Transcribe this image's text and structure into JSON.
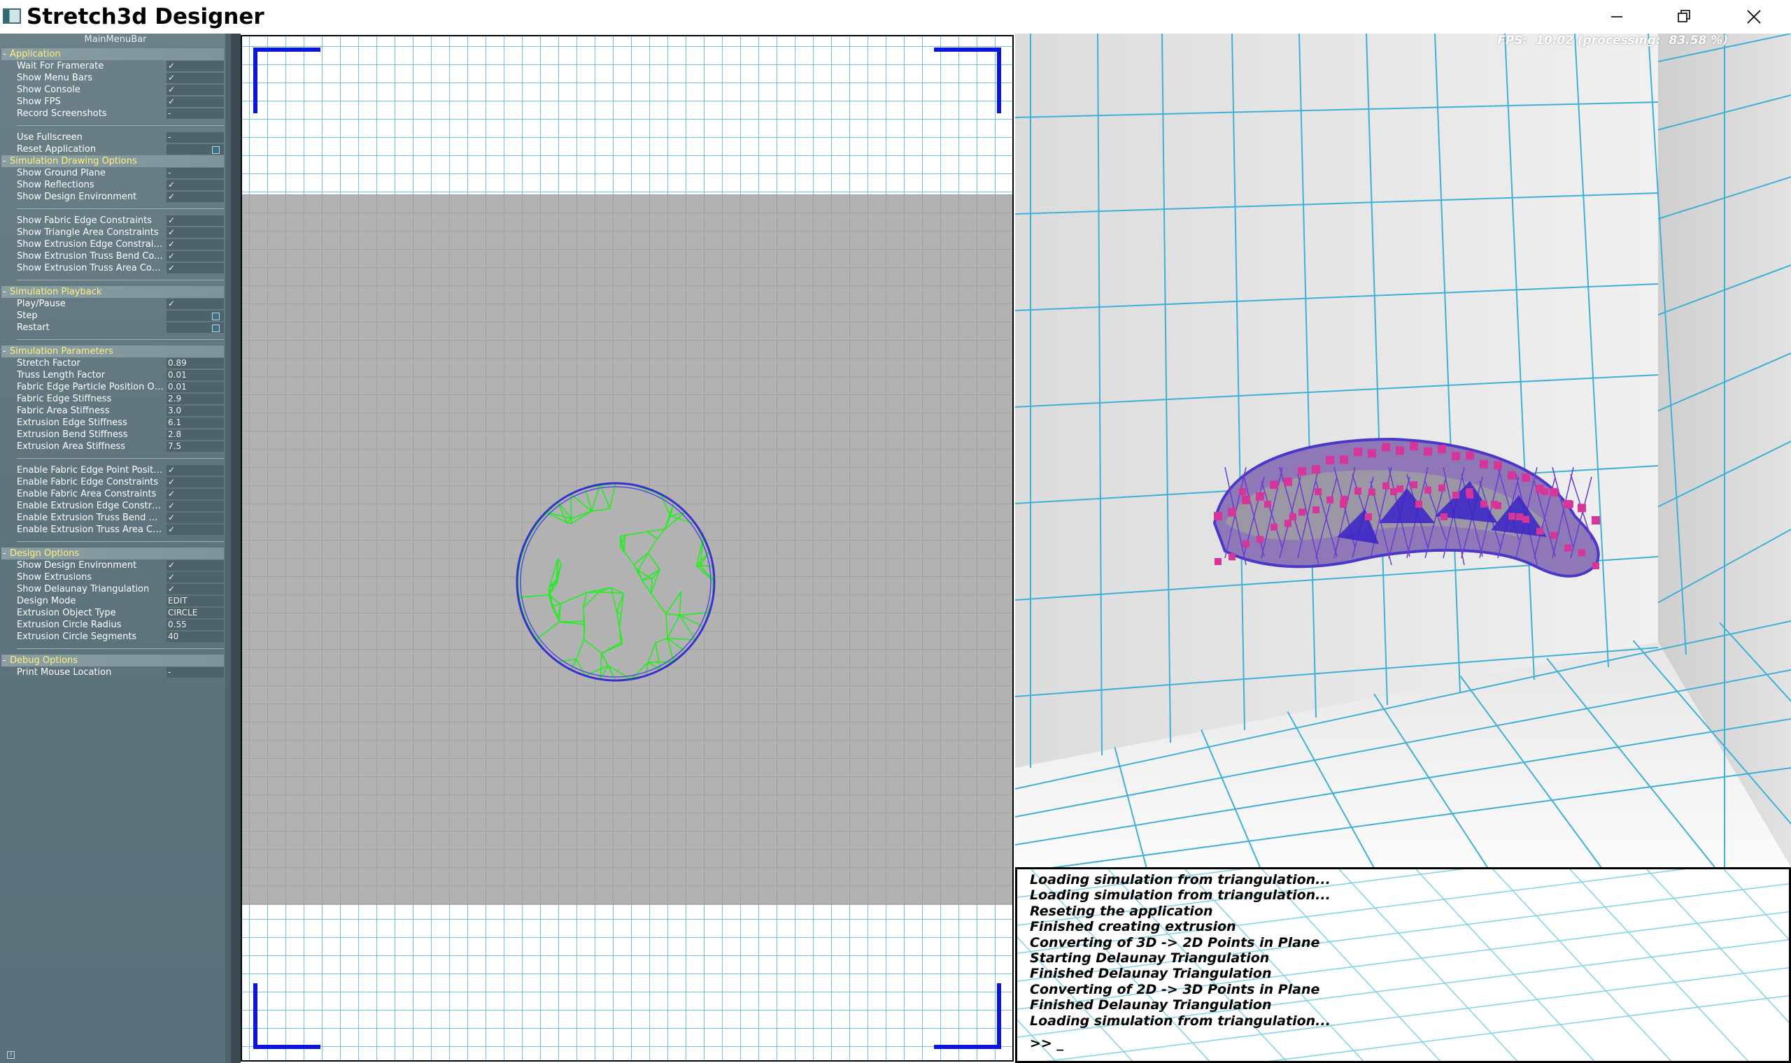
{
  "window": {
    "title": "Stretch3d Designer",
    "controls": {
      "minimize_icon": "minimize-icon",
      "restore_icon": "restore-icon",
      "close_icon": "close-icon"
    }
  },
  "menu_panel": {
    "title": "MainMenuBar",
    "rows": [
      {
        "kind": "section",
        "label": "Application"
      },
      {
        "kind": "item",
        "label": "Wait For Framerate",
        "value": "✓",
        "type": "check"
      },
      {
        "kind": "item",
        "label": "Show Menu Bars",
        "value": "✓",
        "type": "check"
      },
      {
        "kind": "item",
        "label": "Show Console",
        "value": "✓",
        "type": "check"
      },
      {
        "kind": "item",
        "label": "Show FPS",
        "value": "✓",
        "type": "check"
      },
      {
        "kind": "item",
        "label": "Record Screenshots",
        "value": "-",
        "type": "dash"
      },
      {
        "kind": "sep"
      },
      {
        "kind": "item",
        "label": "Use Fullscreen",
        "value": "-",
        "type": "dash"
      },
      {
        "kind": "item",
        "label": "Reset Application",
        "value": "",
        "type": "button"
      },
      {
        "kind": "section",
        "label": "Simulation Drawing Options"
      },
      {
        "kind": "item",
        "label": "Show Ground Plane",
        "value": "-",
        "type": "dash"
      },
      {
        "kind": "item",
        "label": "Show Reflections",
        "value": "✓",
        "type": "check"
      },
      {
        "kind": "item",
        "label": "Show Design Environment",
        "value": "✓",
        "type": "check"
      },
      {
        "kind": "sep"
      },
      {
        "kind": "item",
        "label": "Show Fabric Edge Constraints",
        "value": "✓",
        "type": "check"
      },
      {
        "kind": "item",
        "label": "Show Triangle Area Constraints",
        "value": "✓",
        "type": "check"
      },
      {
        "kind": "item",
        "label": "Show Extrusion Edge Constrain...",
        "value": "✓",
        "type": "check"
      },
      {
        "kind": "item",
        "label": "Show Extrusion Truss Bend Co...",
        "value": "✓",
        "type": "check"
      },
      {
        "kind": "item",
        "label": "Show Extrusion Truss Area Con...",
        "value": "✓",
        "type": "check"
      },
      {
        "kind": "sep"
      },
      {
        "kind": "section",
        "label": "Simulation Playback"
      },
      {
        "kind": "item",
        "label": "Play/Pause",
        "value": "✓",
        "type": "check"
      },
      {
        "kind": "item",
        "label": "Step",
        "value": "",
        "type": "button"
      },
      {
        "kind": "item",
        "label": "Restart",
        "value": "",
        "type": "button"
      },
      {
        "kind": "sep"
      },
      {
        "kind": "section",
        "label": "Simulation Parameters"
      },
      {
        "kind": "item",
        "label": "Stretch Factor",
        "value": "0.89",
        "type": "number"
      },
      {
        "kind": "item",
        "label": "Truss Length Factor",
        "value": "0.01",
        "type": "lownumber"
      },
      {
        "kind": "item",
        "label": "Fabric Edge Particle Position Of...",
        "value": "0.01",
        "type": "lownumber"
      },
      {
        "kind": "item",
        "label": "Fabric Edge Stiffness",
        "value": "2.9",
        "type": "number"
      },
      {
        "kind": "item",
        "label": "Fabric Area Stiffness",
        "value": "3.0",
        "type": "number"
      },
      {
        "kind": "item",
        "label": "Extrusion Edge Stiffness",
        "value": "6.1",
        "type": "number"
      },
      {
        "kind": "item",
        "label": "Extrusion Bend Stiffness",
        "value": "2.8",
        "type": "number"
      },
      {
        "kind": "item",
        "label": "Extrusion Area Stiffness",
        "value": "7.5",
        "type": "number"
      },
      {
        "kind": "sep"
      },
      {
        "kind": "item",
        "label": "Enable Fabric Edge Point Positio...",
        "value": "✓",
        "type": "check"
      },
      {
        "kind": "item",
        "label": "Enable Fabric Edge Constraints",
        "value": "✓",
        "type": "check"
      },
      {
        "kind": "item",
        "label": "Enable Fabric Area  Constraints",
        "value": "✓",
        "type": "check"
      },
      {
        "kind": "item",
        "label": "Enable Extrusion Edge Constrai...",
        "value": "✓",
        "type": "check"
      },
      {
        "kind": "item",
        "label": "Enable Extrusion Truss Bend C...",
        "value": "✓",
        "type": "check"
      },
      {
        "kind": "item",
        "label": "Enable Extrusion Truss Area Co...",
        "value": "✓",
        "type": "check"
      },
      {
        "kind": "sep"
      },
      {
        "kind": "section",
        "label": "Design Options"
      },
      {
        "kind": "item",
        "label": "Show Design Environment",
        "value": "✓",
        "type": "check"
      },
      {
        "kind": "item",
        "label": "Show Extrusions",
        "value": "✓",
        "type": "check"
      },
      {
        "kind": "item",
        "label": "Show Delaunay Triangulation",
        "value": "✓",
        "type": "check"
      },
      {
        "kind": "item",
        "label": "Design Mode",
        "value": "EDIT",
        "type": "text"
      },
      {
        "kind": "item",
        "label": "Extrusion Object Type",
        "value": "CIRCLE",
        "type": "text"
      },
      {
        "kind": "item",
        "label": "Extrusion Circle Radius",
        "value": "0.55",
        "type": "number"
      },
      {
        "kind": "item",
        "label": "Extrusion Circle Segments",
        "value": "40",
        "type": "number"
      },
      {
        "kind": "sep"
      },
      {
        "kind": "section",
        "label": "Debug Options"
      },
      {
        "kind": "item",
        "label": "Print Mouse Location",
        "value": "-",
        "type": "dash"
      }
    ],
    "help_label": "?"
  },
  "design_view": {
    "plane_color": "#b2b2b2",
    "grid_color": "#6fc3de",
    "corner_marker_color": "#0b16d8",
    "mesh_edge_color": "#22ee22",
    "outline_color": "#3a2fd0"
  },
  "sim_view": {
    "fps_label": "FPS:",
    "fps_value": "10.02",
    "processing_label": "(processing:",
    "processing_value": "83.58 %)"
  },
  "console": {
    "lines": [
      "Loading simulation from triangulation...",
      "Loading simulation from triangulation...",
      "Reseting the application",
      "Finished creating extrusion",
      "Converting of 3D -> 2D Points in Plane",
      "Starting Delaunay Triangulation",
      "Finished Delaunay Triangulation",
      "Converting of 2D -> 3D Points in Plane",
      "Finished Delaunay Triangulation",
      "Loading simulation from triangulation..."
    ],
    "prompt": ">> _"
  }
}
